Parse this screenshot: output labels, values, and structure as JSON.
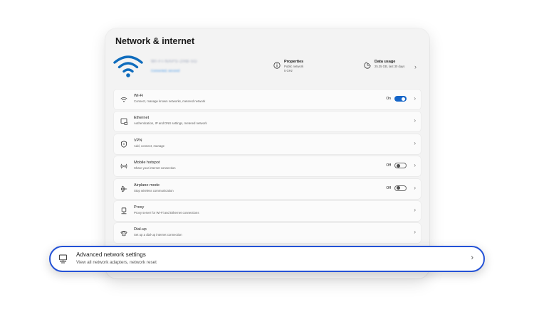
{
  "page": {
    "title": "Network & internet"
  },
  "header": {
    "network_name": "WI-FI-NAPS-2HB-5G",
    "network_status": "Connected, secured",
    "properties": {
      "icon": "info-icon",
      "title": "Properties",
      "line1": "Public network",
      "line2": "5 GHz"
    },
    "data_usage": {
      "icon": "data-usage-icon",
      "title": "Data usage",
      "line1": "25.35 GB, last 30 days"
    }
  },
  "rows": [
    {
      "icon": "wifi-icon",
      "title": "Wi-Fi",
      "subtitle": "Connect, manage known networks, metered network",
      "toggle_label": "On",
      "toggle_state": true
    },
    {
      "icon": "ethernet-icon",
      "title": "Ethernet",
      "subtitle": "Authentication, IP and DNS settings, metered network"
    },
    {
      "icon": "vpn-shield-icon",
      "title": "VPN",
      "subtitle": "Add, connect, manage"
    },
    {
      "icon": "mobile-hotspot-icon",
      "title": "Mobile hotspot",
      "subtitle": "Share your internet connection",
      "toggle_label": "Off",
      "toggle_state": false
    },
    {
      "icon": "airplane-icon",
      "title": "Airplane mode",
      "subtitle": "Stop wireless communication",
      "toggle_label": "Off",
      "toggle_state": false
    },
    {
      "icon": "proxy-icon",
      "title": "Proxy",
      "subtitle": "Proxy server for Wi-Fi and Ethernet connections"
    },
    {
      "icon": "dial-up-icon",
      "title": "Dial-up",
      "subtitle": "Set up a dial-up internet connection"
    }
  ],
  "advanced": {
    "icon": "network-computer-icon",
    "title": "Advanced network settings",
    "subtitle": "View all network adapters, network reset"
  },
  "colors": {
    "accent": "#1565c8",
    "highlight_border": "#2452d6",
    "wifi_icon": "#0f6cbd"
  }
}
